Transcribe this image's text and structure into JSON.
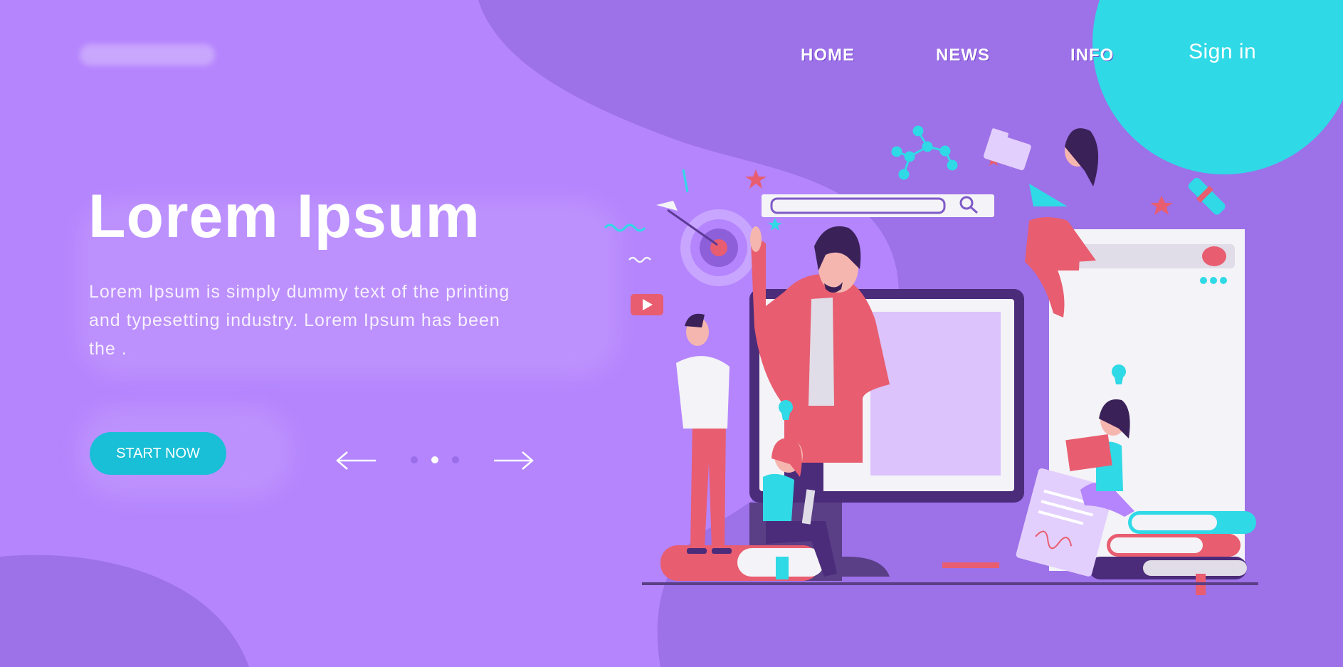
{
  "colors": {
    "background": "#b585fd",
    "blob_dark": "#9d71e8",
    "corner_circle": "#2fd9e6",
    "button": "#18bfd6",
    "accent_red": "#e85d70",
    "monitor_frame": "#4b2c7a"
  },
  "nav": {
    "items": [
      {
        "label": "HOME"
      },
      {
        "label": "NEWS"
      },
      {
        "label": "INFO"
      }
    ],
    "sign_in": "Sign in"
  },
  "hero": {
    "title": "Lorem Ipsum",
    "body": "Lorem Ipsum is simply dummy text of the printing and typesetting industry. Lorem Ipsum has been the .",
    "cta": "START NOW"
  },
  "carousel": {
    "slide_count": 3,
    "active_slide": 2,
    "prev_icon": "arrow-left-icon",
    "next_icon": "arrow-right-icon"
  },
  "illustration": {
    "subject": "online-education-team-illustration"
  }
}
